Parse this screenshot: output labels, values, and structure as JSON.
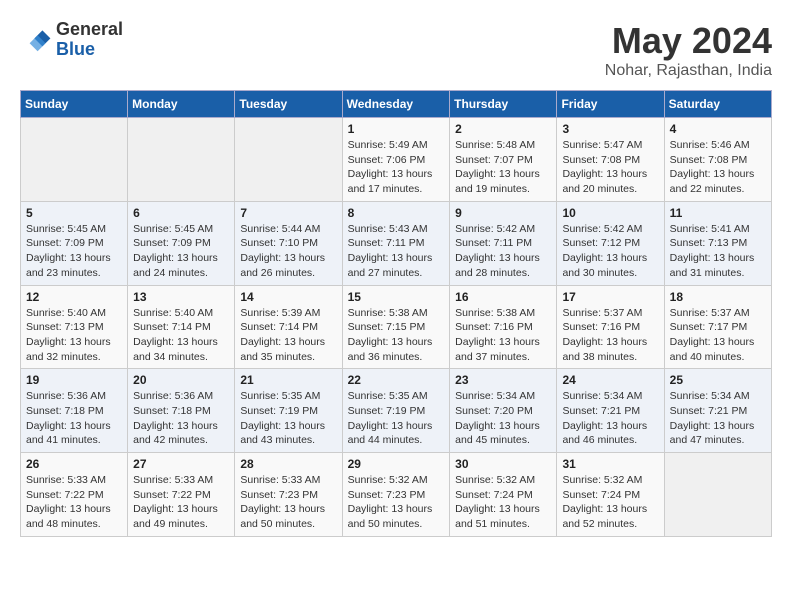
{
  "header": {
    "logo_line1": "General",
    "logo_line2": "Blue",
    "month": "May 2024",
    "location": "Nohar, Rajasthan, India"
  },
  "weekdays": [
    "Sunday",
    "Monday",
    "Tuesday",
    "Wednesday",
    "Thursday",
    "Friday",
    "Saturday"
  ],
  "weeks": [
    [
      {
        "day": "",
        "info": ""
      },
      {
        "day": "",
        "info": ""
      },
      {
        "day": "",
        "info": ""
      },
      {
        "day": "1",
        "info": "Sunrise: 5:49 AM\nSunset: 7:06 PM\nDaylight: 13 hours\nand 17 minutes."
      },
      {
        "day": "2",
        "info": "Sunrise: 5:48 AM\nSunset: 7:07 PM\nDaylight: 13 hours\nand 19 minutes."
      },
      {
        "day": "3",
        "info": "Sunrise: 5:47 AM\nSunset: 7:08 PM\nDaylight: 13 hours\nand 20 minutes."
      },
      {
        "day": "4",
        "info": "Sunrise: 5:46 AM\nSunset: 7:08 PM\nDaylight: 13 hours\nand 22 minutes."
      }
    ],
    [
      {
        "day": "5",
        "info": "Sunrise: 5:45 AM\nSunset: 7:09 PM\nDaylight: 13 hours\nand 23 minutes."
      },
      {
        "day": "6",
        "info": "Sunrise: 5:45 AM\nSunset: 7:09 PM\nDaylight: 13 hours\nand 24 minutes."
      },
      {
        "day": "7",
        "info": "Sunrise: 5:44 AM\nSunset: 7:10 PM\nDaylight: 13 hours\nand 26 minutes."
      },
      {
        "day": "8",
        "info": "Sunrise: 5:43 AM\nSunset: 7:11 PM\nDaylight: 13 hours\nand 27 minutes."
      },
      {
        "day": "9",
        "info": "Sunrise: 5:42 AM\nSunset: 7:11 PM\nDaylight: 13 hours\nand 28 minutes."
      },
      {
        "day": "10",
        "info": "Sunrise: 5:42 AM\nSunset: 7:12 PM\nDaylight: 13 hours\nand 30 minutes."
      },
      {
        "day": "11",
        "info": "Sunrise: 5:41 AM\nSunset: 7:13 PM\nDaylight: 13 hours\nand 31 minutes."
      }
    ],
    [
      {
        "day": "12",
        "info": "Sunrise: 5:40 AM\nSunset: 7:13 PM\nDaylight: 13 hours\nand 32 minutes."
      },
      {
        "day": "13",
        "info": "Sunrise: 5:40 AM\nSunset: 7:14 PM\nDaylight: 13 hours\nand 34 minutes."
      },
      {
        "day": "14",
        "info": "Sunrise: 5:39 AM\nSunset: 7:14 PM\nDaylight: 13 hours\nand 35 minutes."
      },
      {
        "day": "15",
        "info": "Sunrise: 5:38 AM\nSunset: 7:15 PM\nDaylight: 13 hours\nand 36 minutes."
      },
      {
        "day": "16",
        "info": "Sunrise: 5:38 AM\nSunset: 7:16 PM\nDaylight: 13 hours\nand 37 minutes."
      },
      {
        "day": "17",
        "info": "Sunrise: 5:37 AM\nSunset: 7:16 PM\nDaylight: 13 hours\nand 38 minutes."
      },
      {
        "day": "18",
        "info": "Sunrise: 5:37 AM\nSunset: 7:17 PM\nDaylight: 13 hours\nand 40 minutes."
      }
    ],
    [
      {
        "day": "19",
        "info": "Sunrise: 5:36 AM\nSunset: 7:18 PM\nDaylight: 13 hours\nand 41 minutes."
      },
      {
        "day": "20",
        "info": "Sunrise: 5:36 AM\nSunset: 7:18 PM\nDaylight: 13 hours\nand 42 minutes."
      },
      {
        "day": "21",
        "info": "Sunrise: 5:35 AM\nSunset: 7:19 PM\nDaylight: 13 hours\nand 43 minutes."
      },
      {
        "day": "22",
        "info": "Sunrise: 5:35 AM\nSunset: 7:19 PM\nDaylight: 13 hours\nand 44 minutes."
      },
      {
        "day": "23",
        "info": "Sunrise: 5:34 AM\nSunset: 7:20 PM\nDaylight: 13 hours\nand 45 minutes."
      },
      {
        "day": "24",
        "info": "Sunrise: 5:34 AM\nSunset: 7:21 PM\nDaylight: 13 hours\nand 46 minutes."
      },
      {
        "day": "25",
        "info": "Sunrise: 5:34 AM\nSunset: 7:21 PM\nDaylight: 13 hours\nand 47 minutes."
      }
    ],
    [
      {
        "day": "26",
        "info": "Sunrise: 5:33 AM\nSunset: 7:22 PM\nDaylight: 13 hours\nand 48 minutes."
      },
      {
        "day": "27",
        "info": "Sunrise: 5:33 AM\nSunset: 7:22 PM\nDaylight: 13 hours\nand 49 minutes."
      },
      {
        "day": "28",
        "info": "Sunrise: 5:33 AM\nSunset: 7:23 PM\nDaylight: 13 hours\nand 50 minutes."
      },
      {
        "day": "29",
        "info": "Sunrise: 5:32 AM\nSunset: 7:23 PM\nDaylight: 13 hours\nand 50 minutes."
      },
      {
        "day": "30",
        "info": "Sunrise: 5:32 AM\nSunset: 7:24 PM\nDaylight: 13 hours\nand 51 minutes."
      },
      {
        "day": "31",
        "info": "Sunrise: 5:32 AM\nSunset: 7:24 PM\nDaylight: 13 hours\nand 52 minutes."
      },
      {
        "day": "",
        "info": ""
      }
    ]
  ]
}
